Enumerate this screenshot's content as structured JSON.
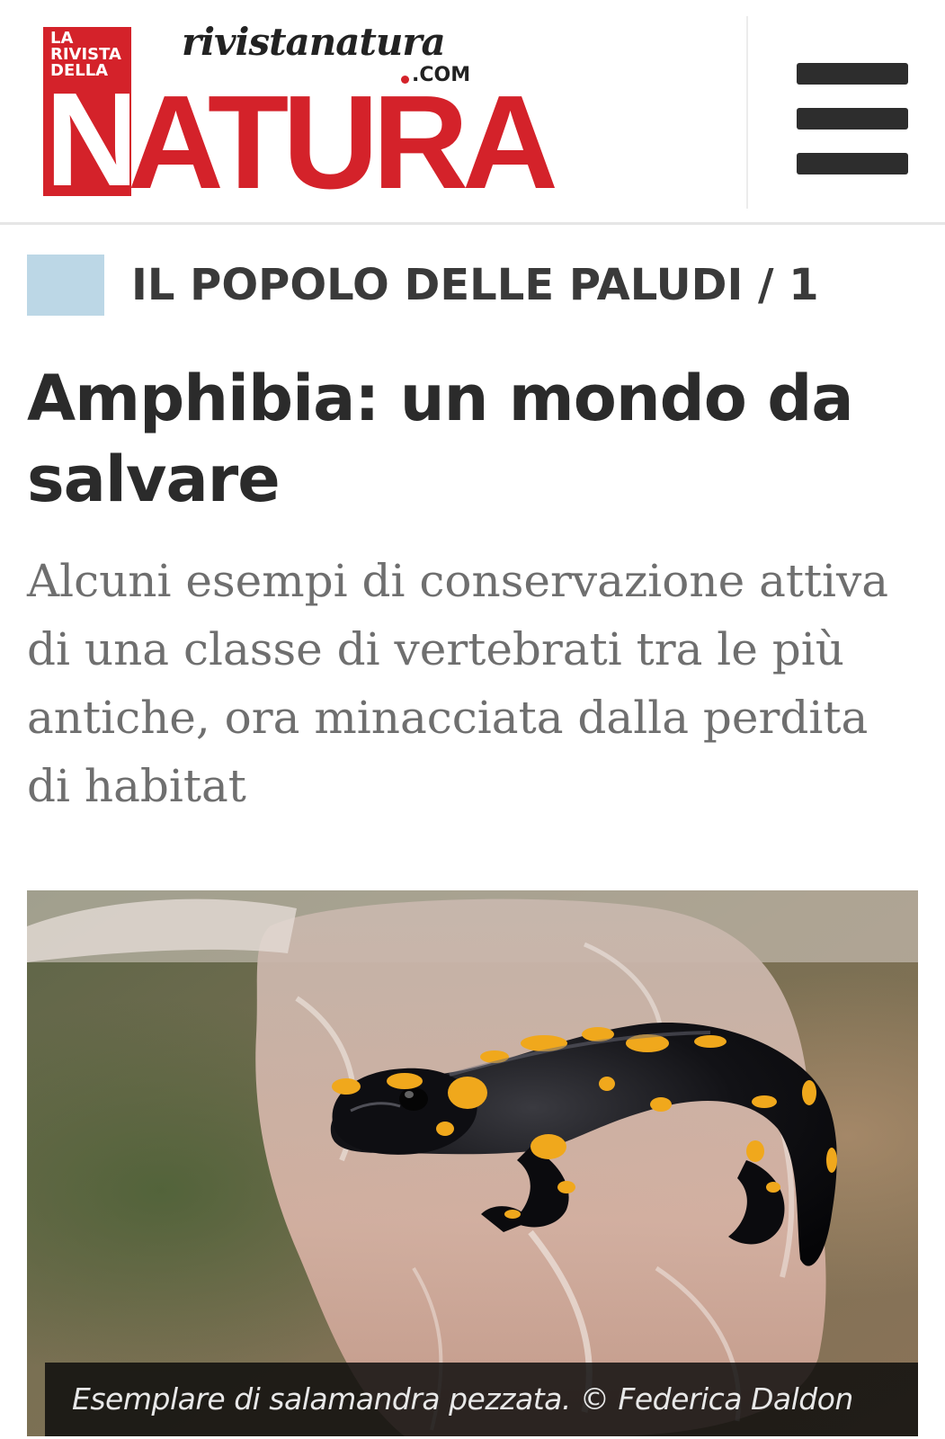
{
  "header": {
    "logo": {
      "box_text": "LA\nRIVISTA\nDELLA",
      "wordmark_first_letter": "N",
      "wordmark_rest": "ATURA",
      "site_name": "rivistanatura",
      "site_tld": ".COM",
      "brand_red": "#d4222a"
    },
    "menu_icon": "hamburger-menu-icon"
  },
  "article": {
    "category": "IL POPOLO DELLE PALUDI / 1",
    "category_color": "#bcd7e6",
    "title": "Amphibia: un mondo da salvare",
    "subtitle": "Alcuni esempi di conservazione attiva di una classe di vertebrati tra le più antiche, ora minacciata dalla perdita di habitat",
    "image": {
      "subject": "fire-salamander-photo",
      "caption": "Esemplare di salamandra pezzata. © Federica Daldon"
    }
  }
}
